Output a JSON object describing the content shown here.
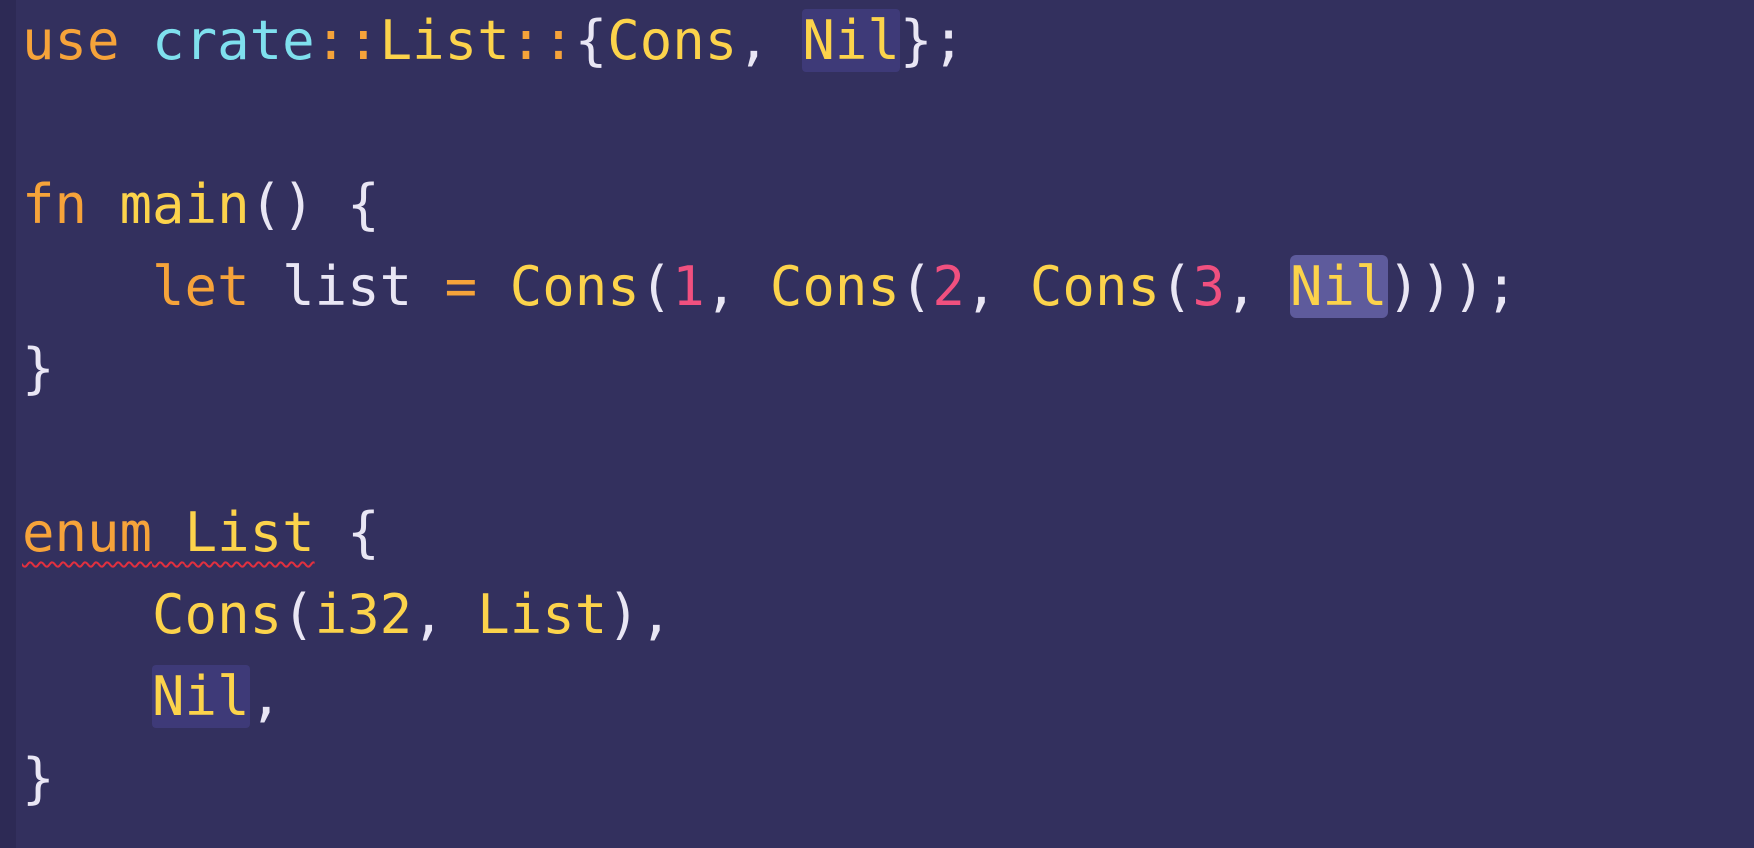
{
  "editor": {
    "language": "rust",
    "highlight_word": "Nil",
    "error_squiggle": "enum List",
    "lines": [
      [
        {
          "t": "use",
          "c": "kw"
        },
        {
          "t": " ",
          "c": "id"
        },
        {
          "t": "crate",
          "c": "mod"
        },
        {
          "t": "::",
          "c": "op"
        },
        {
          "t": "List",
          "c": "ty"
        },
        {
          "t": "::",
          "c": "op"
        },
        {
          "t": "{",
          "c": "pun"
        },
        {
          "t": "Cons",
          "c": "ty"
        },
        {
          "t": ", ",
          "c": "pun"
        },
        {
          "t": "Nil",
          "c": "ty",
          "hl": "soft"
        },
        {
          "t": "};",
          "c": "pun"
        }
      ],
      [],
      [
        {
          "t": "fn",
          "c": "kw"
        },
        {
          "t": " ",
          "c": "id"
        },
        {
          "t": "main",
          "c": "fn"
        },
        {
          "t": "() {",
          "c": "pun"
        }
      ],
      [
        {
          "t": "    ",
          "c": "id"
        },
        {
          "t": "let",
          "c": "kw"
        },
        {
          "t": " list ",
          "c": "id"
        },
        {
          "t": "=",
          "c": "op"
        },
        {
          "t": " ",
          "c": "id"
        },
        {
          "t": "Cons",
          "c": "ty"
        },
        {
          "t": "(",
          "c": "pun"
        },
        {
          "t": "1",
          "c": "num"
        },
        {
          "t": ", ",
          "c": "pun"
        },
        {
          "t": "Cons",
          "c": "ty"
        },
        {
          "t": "(",
          "c": "pun"
        },
        {
          "t": "2",
          "c": "num"
        },
        {
          "t": ", ",
          "c": "pun"
        },
        {
          "t": "Cons",
          "c": "ty"
        },
        {
          "t": "(",
          "c": "pun"
        },
        {
          "t": "3",
          "c": "num"
        },
        {
          "t": ", ",
          "c": "pun"
        },
        {
          "t": "Nil",
          "c": "ty",
          "hl": "strong"
        },
        {
          "t": ")));",
          "c": "pun"
        }
      ],
      [
        {
          "t": "}",
          "c": "pun"
        }
      ],
      [],
      [
        {
          "t": "enum",
          "c": "kw",
          "sq": true
        },
        {
          "t": " ",
          "c": "id",
          "sq": true
        },
        {
          "t": "List",
          "c": "ty",
          "sq": true
        },
        {
          "t": " {",
          "c": "pun"
        }
      ],
      [
        {
          "t": "    ",
          "c": "id"
        },
        {
          "t": "Cons",
          "c": "ty"
        },
        {
          "t": "(",
          "c": "pun"
        },
        {
          "t": "i32",
          "c": "ty"
        },
        {
          "t": ", ",
          "c": "pun"
        },
        {
          "t": "List",
          "c": "ty"
        },
        {
          "t": "),",
          "c": "pun"
        }
      ],
      [
        {
          "t": "    ",
          "c": "id"
        },
        {
          "t": "Nil",
          "c": "ty",
          "hl": "soft"
        },
        {
          "t": ",",
          "c": "pun"
        }
      ],
      [
        {
          "t": "}",
          "c": "pun"
        }
      ]
    ]
  },
  "colors": {
    "background": "#33305e",
    "keyword": "#f6a33a",
    "type": "#fcd34b",
    "module": "#7fe0ee",
    "number": "#f0507f",
    "text": "#e9e6f4",
    "error": "#e2303f"
  }
}
